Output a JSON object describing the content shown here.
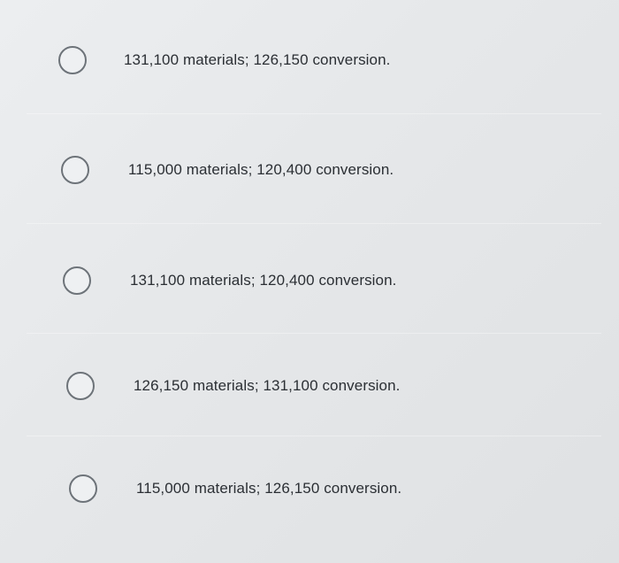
{
  "question": {
    "options": [
      {
        "label": "131,100 materials; 126,150 conversion.",
        "selected": false
      },
      {
        "label": "115,000 materials; 120,400 conversion.",
        "selected": false
      },
      {
        "label": "131,100 materials; 120,400 conversion.",
        "selected": false
      },
      {
        "label": "126,150 materials; 131,100 conversion.",
        "selected": false
      },
      {
        "label": "115,000 materials; 126,150 conversion.",
        "selected": false
      }
    ]
  }
}
